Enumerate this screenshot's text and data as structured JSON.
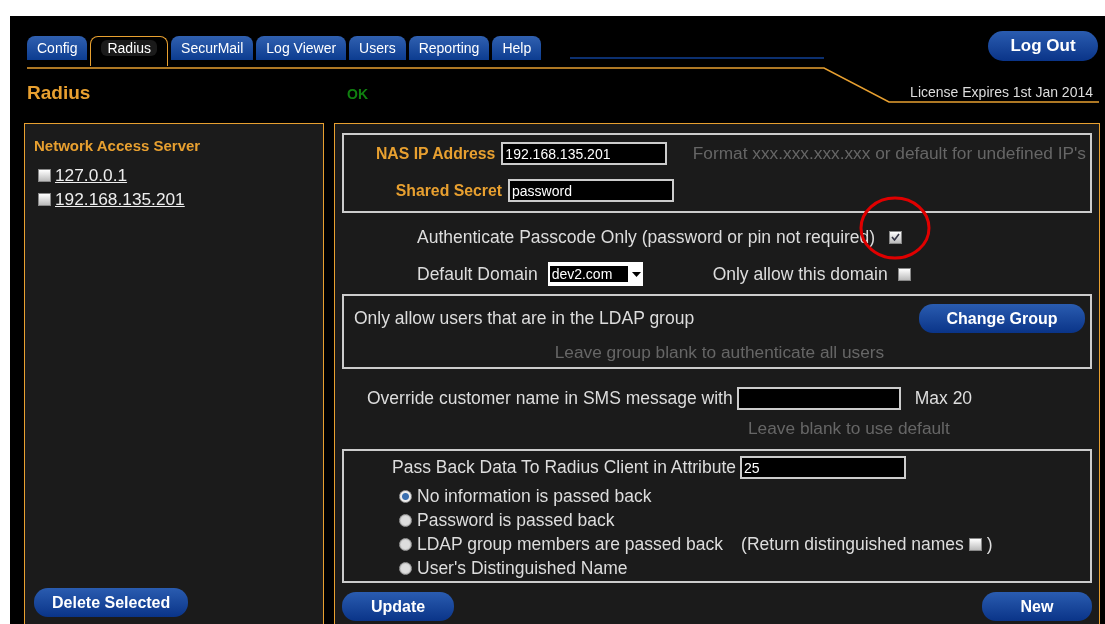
{
  "tabs": [
    {
      "label": "Config",
      "selected": false
    },
    {
      "label": "Radius",
      "selected": true
    },
    {
      "label": "SecurMail",
      "selected": false
    },
    {
      "label": "Log Viewer",
      "selected": false
    },
    {
      "label": "Users",
      "selected": false
    },
    {
      "label": "Reporting",
      "selected": false
    },
    {
      "label": "Help",
      "selected": false
    }
  ],
  "logout": "Log Out",
  "page_title": "Radius",
  "status": "OK",
  "license": "License Expires 1st Jan 2014",
  "sidebar": {
    "title": "Network Access Server",
    "items": [
      {
        "label": "127.0.0.1",
        "checked": false
      },
      {
        "label": "192.168.135.201",
        "checked": false
      }
    ],
    "button": "Delete Selected"
  },
  "nas": {
    "ip_label": "NAS IP Address",
    "ip_value": "192.168.135.201",
    "ip_hint": "Format xxx.xxx.xxx.xxx or default for undefined IP's",
    "secret_label": "Shared Secret",
    "secret_value": "password"
  },
  "passcode_only": {
    "label": "Authenticate Passcode Only (password or pin not required)",
    "checked": true,
    "highlight": {
      "kind": "circle"
    }
  },
  "domain": {
    "label": "Default Domain",
    "value": "dev2.com",
    "only_label": "Only allow this domain",
    "only_checked": false
  },
  "ldap": {
    "label": "Only allow users that are in the LDAP group",
    "button": "Change Group",
    "hint": "Leave group blank to authenticate all users"
  },
  "sms": {
    "label": "Override customer name in SMS message with",
    "max": "Max 20",
    "hint": "Leave blank to use default"
  },
  "passback": {
    "label": "Pass Back Data To Radius Client in Attribute",
    "value": "25",
    "options": [
      {
        "label": "No information is passed back",
        "selected": true
      },
      {
        "label": "Password is passed back",
        "selected": false
      },
      {
        "label": "LDAP group members are passed back",
        "selected": false,
        "extra": {
          "open": "(Return distinguished names",
          "checked": false,
          "close": ")"
        }
      },
      {
        "label": "User's Distinguished Name",
        "selected": false
      }
    ]
  },
  "buttons": {
    "update": "Update",
    "new": "New"
  }
}
